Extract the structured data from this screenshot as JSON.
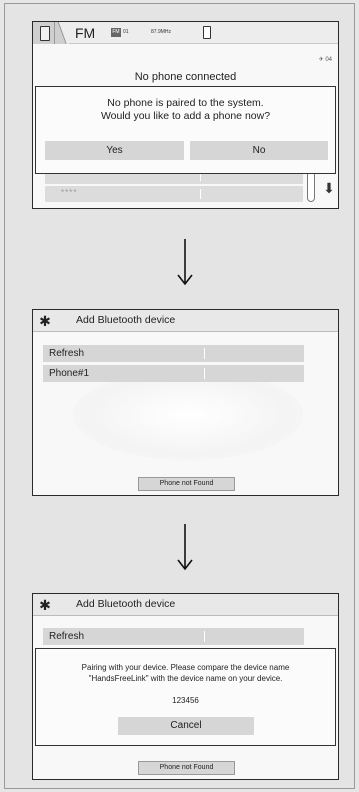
{
  "screen1": {
    "band": "FM",
    "preset_badge": "FM",
    "preset": "01",
    "frequency": "87.9MHz",
    "status": "04",
    "no_phone_connected": "No phone connected",
    "dialog": {
      "line1": "No phone is paired to the system.",
      "line2": "Would you like to add a phone now?",
      "yes": "Yes",
      "no": "No"
    },
    "masked_entry": "****"
  },
  "screen2": {
    "title": "Add Bluetooth device",
    "items": [
      {
        "label": "Refresh"
      },
      {
        "label": "Phone#1"
      }
    ],
    "phone_not_found": "Phone not Found"
  },
  "screen3": {
    "title": "Add Bluetooth device",
    "refresh": "Refresh",
    "dialog": {
      "line1": "Pairing with your device. Please compare the device name",
      "line2": "\"HandsFreeLink\" with the device name on your device.",
      "code": "123456",
      "cancel": "Cancel"
    },
    "phone_not_found": "Phone not Found"
  },
  "colors": {
    "background": "#e6e6e6",
    "screen": "#f8f8f8",
    "button": "#d6d6d6",
    "border": "#2a2a2a"
  },
  "icons": {
    "phone_tab": "phone-icon",
    "settings": "gear-icon",
    "arrow": "down-arrow-icon",
    "scroll": "double-chevron-down-icon"
  }
}
